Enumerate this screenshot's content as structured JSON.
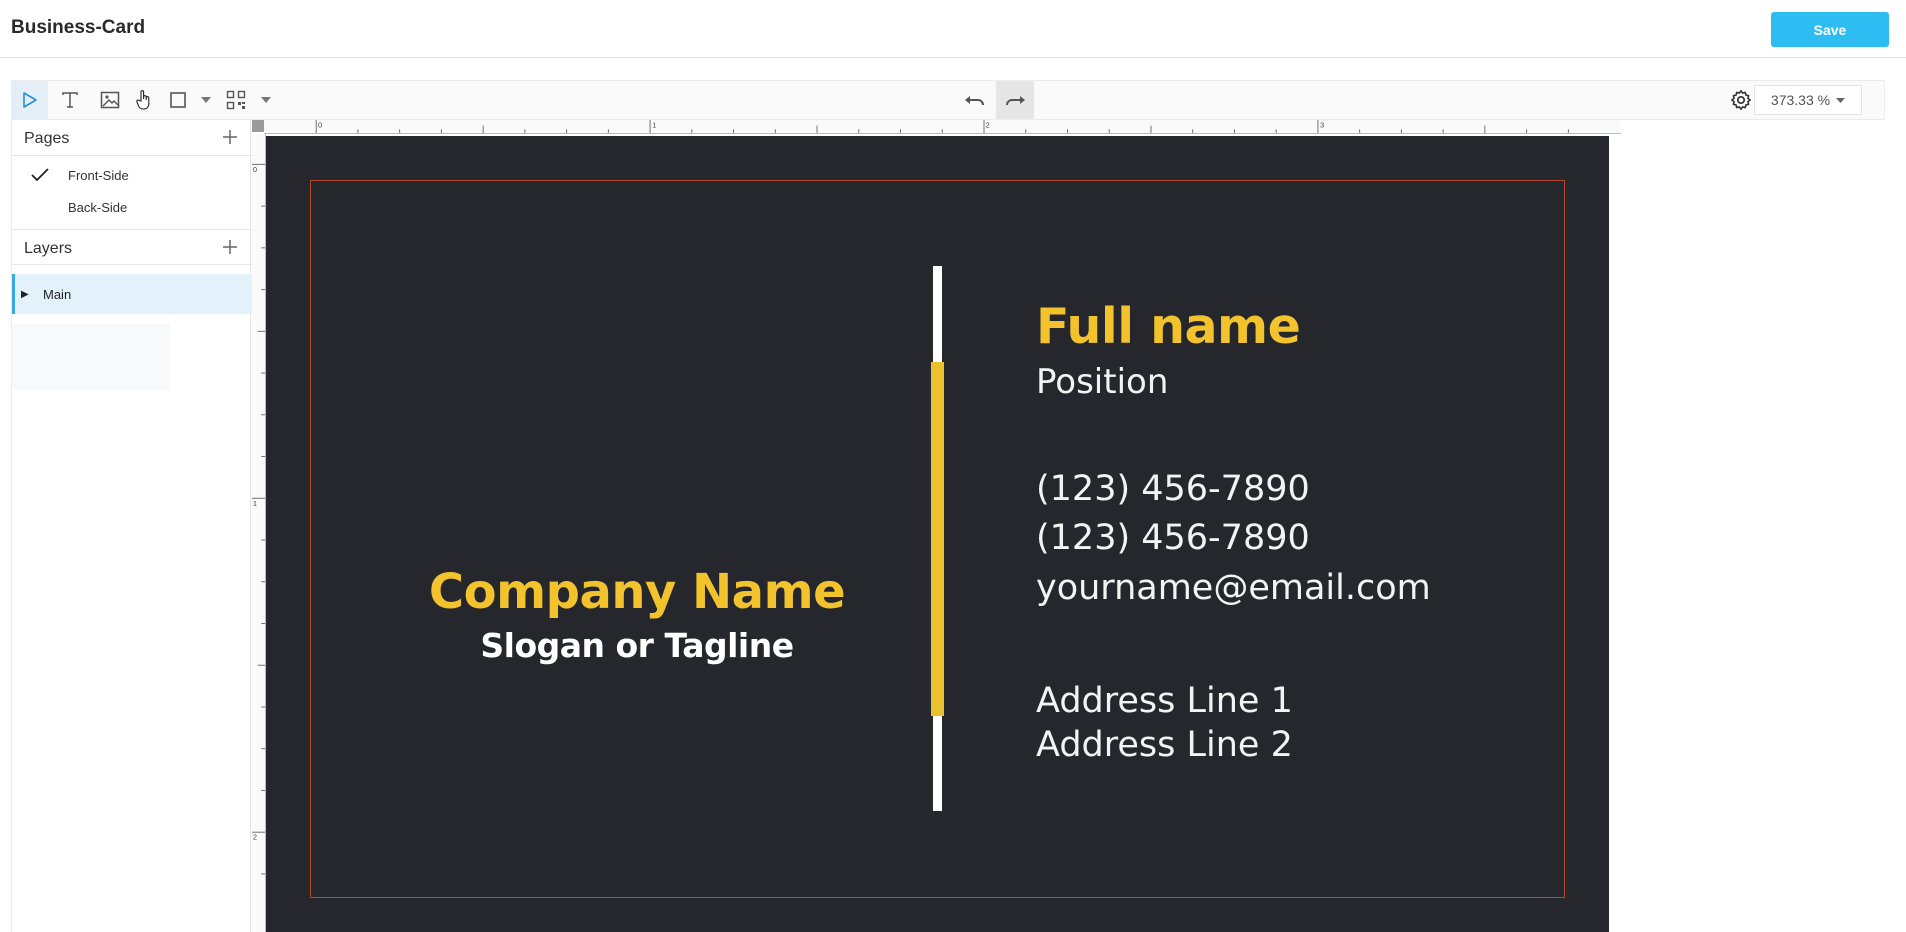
{
  "header": {
    "title": "Business-Card",
    "save_label": "Save"
  },
  "toolbar": {
    "tools": [
      "select-icon",
      "text-icon",
      "image-icon",
      "hand-icon",
      "rectangle-icon",
      "qr-code-icon"
    ],
    "undo_icon": "undo-icon",
    "redo_icon": "redo-icon",
    "settings_icon": "gear-icon",
    "zoom": "373.33 %"
  },
  "pages_panel": {
    "title": "Pages",
    "items": [
      {
        "label": "Front-Side",
        "selected": true
      },
      {
        "label": "Back-Side",
        "selected": false
      }
    ]
  },
  "layers_panel": {
    "title": "Layers",
    "items": [
      {
        "label": "Main",
        "selected": true
      }
    ]
  },
  "rulers": {
    "top_labels": [
      "0",
      "1",
      "2",
      "3"
    ],
    "left_labels": [
      "0",
      "1",
      "2"
    ]
  },
  "card": {
    "company_name": "Company Name",
    "slogan": "Slogan or Tagline",
    "full_name": "Full name",
    "position": "Position",
    "phone_1": "(123) 456-7890",
    "phone_2": "(123) 456-7890",
    "email": "yourname@email.com",
    "address_1": "Address Line 1",
    "address_2": "Address Line 2"
  },
  "colors": {
    "accent": "#2ebdf2",
    "card_background": "#25272c",
    "card_highlight": "#f2c32c",
    "card_text": "#f3f3f3",
    "safe_border": "#b6432f"
  }
}
